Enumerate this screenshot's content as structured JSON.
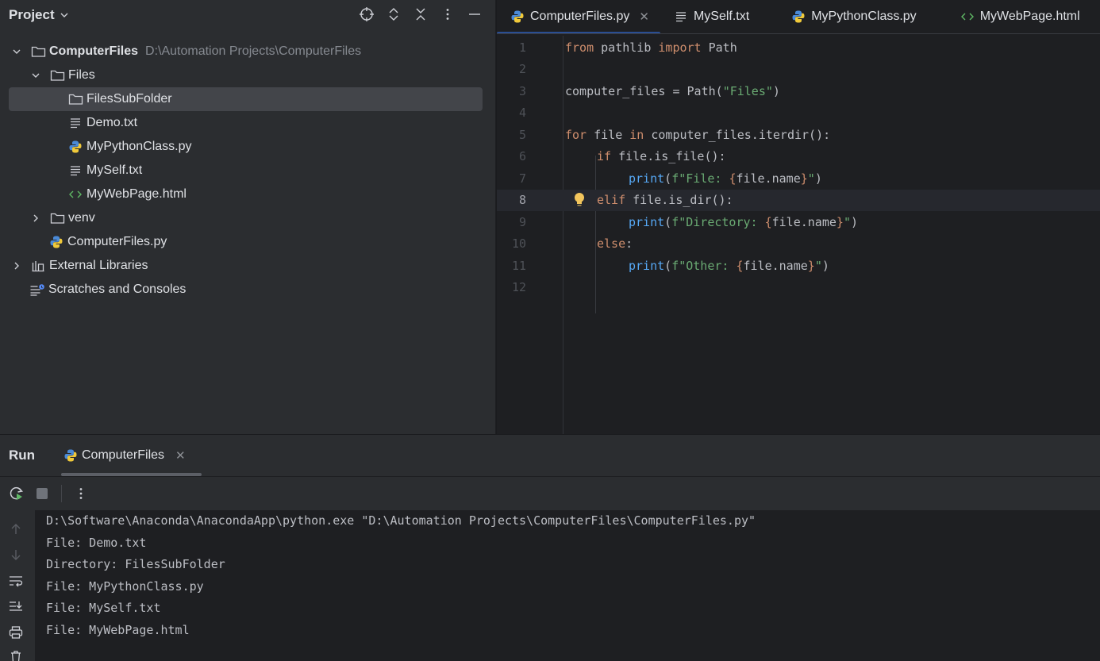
{
  "project_panel": {
    "title": "Project",
    "tree": [
      {
        "label": "ComputerFiles",
        "hint": "D:\\Automation Projects\\ComputerFiles"
      },
      {
        "label": "Files"
      },
      {
        "label": "FilesSubFolder"
      },
      {
        "label": "Demo.txt"
      },
      {
        "label": "MyPythonClass.py"
      },
      {
        "label": "MySelf.txt"
      },
      {
        "label": "MyWebPage.html"
      },
      {
        "label": "venv"
      },
      {
        "label": "ComputerFiles.py"
      },
      {
        "label": "External Libraries"
      },
      {
        "label": "Scratches and Consoles"
      }
    ]
  },
  "editor": {
    "tabs": [
      {
        "label": "ComputerFiles.py",
        "icon": "python-file-icon"
      },
      {
        "label": "MySelf.txt",
        "icon": "text-file-icon"
      },
      {
        "label": "MyPythonClass.py",
        "icon": "python-file-icon"
      },
      {
        "label": "MyWebPage.html",
        "icon": "html-file-icon"
      }
    ],
    "current_line": 8,
    "line_numbers": [
      "1",
      "2",
      "3",
      "4",
      "5",
      "6",
      "7",
      "8",
      "9",
      "10",
      "11",
      "12"
    ],
    "code": {
      "l1_from": "from",
      "l1_mod": " pathlib ",
      "l1_import": "import",
      "l1_name": " Path",
      "l3_a": "computer_files = Path(",
      "l3_str": "\"Files\"",
      "l3_b": ")",
      "l5_for": "for",
      "l5_a": " file ",
      "l5_in": "in",
      "l5_b": " computer_files.iterdir():",
      "l6_if": "if",
      "l6_a": " file.is_file():",
      "l7_print": "print",
      "l7_a": "(",
      "l7_str1": "f\"File: ",
      "l7_br1": "{",
      "l7_expr": "file.name",
      "l7_br2": "}",
      "l7_str2": "\"",
      "l7_b": ")",
      "l8_elif": "elif",
      "l8_a": " file.is_dir():",
      "l9_print": "print",
      "l9_a": "(",
      "l9_str1": "f\"Directory: ",
      "l9_br1": "{",
      "l9_expr": "file.name",
      "l9_br2": "}",
      "l9_str2": "\"",
      "l9_b": ")",
      "l10_else": "else",
      "l10_a": ":",
      "l11_print": "print",
      "l11_a": "(",
      "l11_str1": "f\"Other: ",
      "l11_br1": "{",
      "l11_expr": "file.name",
      "l11_br2": "}",
      "l11_str2": "\"",
      "l11_b": ")"
    }
  },
  "run_panel": {
    "title": "Run",
    "tab_label": "ComputerFiles",
    "console": [
      "D:\\Software\\Anaconda\\AnacondaApp\\python.exe \"D:\\Automation Projects\\ComputerFiles\\ComputerFiles.py\"",
      "File: Demo.txt",
      "Directory: FilesSubFolder",
      "File: MyPythonClass.py",
      "File: MySelf.txt",
      "File: MyWebPage.html"
    ]
  },
  "colors": {
    "keyword": "#cf8e6d",
    "string": "#6aab73",
    "function": "#56a8f5",
    "background": "#1e1f22",
    "panel": "#2b2d30"
  }
}
